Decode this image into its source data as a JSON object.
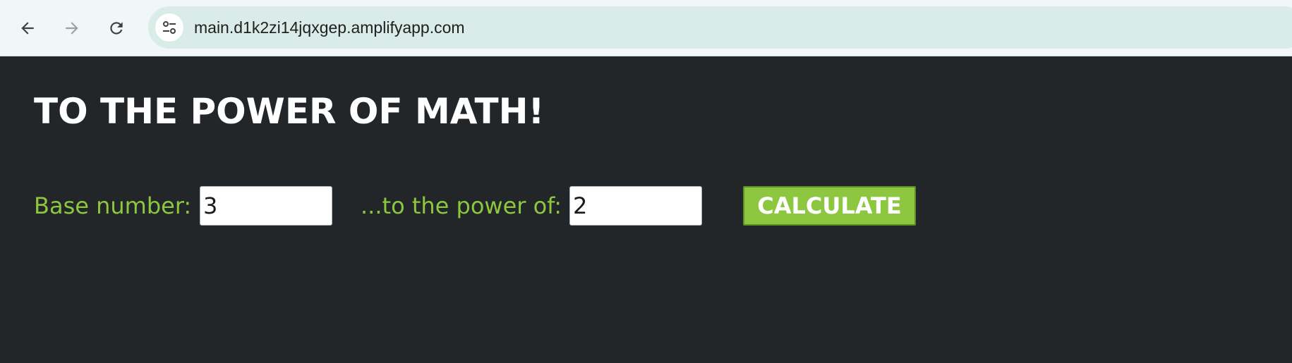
{
  "browser": {
    "url": "main.d1k2zi14jqxgep.amplifyapp.com",
    "icons": {
      "back": "back-arrow-icon",
      "forward": "forward-arrow-icon",
      "reload": "reload-icon",
      "site_info": "tune-icon"
    }
  },
  "page": {
    "title": "TO THE POWER OF MATH!",
    "base_label": "Base number:",
    "base_value": "3",
    "power_label": "...to the power of:",
    "power_value": "2",
    "calculate_label": "CALCULATE"
  },
  "colors": {
    "background": "#232629",
    "accent": "#8dc63f",
    "title": "#ffffff",
    "browser_bar": "#f1f7f6",
    "omnibox": "#d9ece8"
  }
}
